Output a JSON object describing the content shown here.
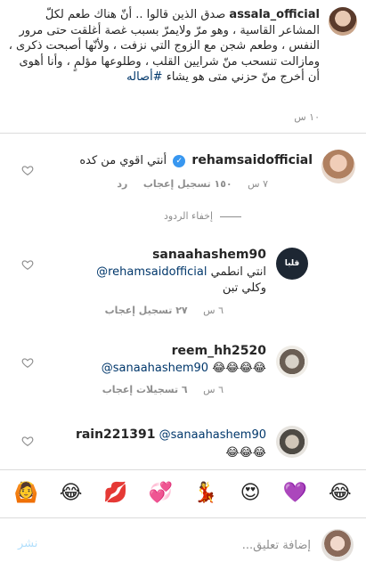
{
  "caption": {
    "username": "assala_official",
    "text_part1": "صدق الذين قالوا .. أنّ هناك طعم لكلّ المشاعر القاسية ، وهو مرّ ولايمرّ بسبب غصة أغلقت حتى مرور النفس ، وطعم شجن مع الزوج التي نزفت ، ولأنّها أصبحت ذكرى ، ومازالت تنسحب منّ شرايين القلب ، وطلوعها مؤلمٍ ، وأنا أهوى أن أخرج منّ حزني متى هو يشاء",
    "hashtag": "#أصاله",
    "time": "١٠ س"
  },
  "comments": [
    {
      "username": "rehamsaidofficial",
      "verified_mark": "✓",
      "text": "أنتي اقوي من كده",
      "time": "٧ س",
      "likes": "١٥٠ تسجيل إعجاب",
      "reply": "رد"
    },
    {
      "username": "sanaahashem90",
      "mention": "@rehamsaidofficial",
      "text_a": "انتي انطمي",
      "text_b": "وكلي تبن",
      "time": "٦ س",
      "likes": "٢٧ تسجيل إعجاب",
      "avatar_text": "قلبا"
    },
    {
      "username": "reem_hh2520",
      "mention": "@sanaahashem90",
      "emojis": "😂😂😂😂",
      "time": "٦ س",
      "likes": "٦ تسجيلات إعجاب"
    },
    {
      "username": "rain221391",
      "mention": "@sanaahashem90",
      "emojis": "😂😂😂"
    }
  ],
  "hide_replies": "إخفاء الردود",
  "emoji_bar": [
    "🙆",
    "😂",
    "💋",
    "💞",
    "💃",
    "😍",
    "💜",
    "😂"
  ],
  "input": {
    "placeholder": "إضافة تعليق...",
    "post_label": "نشر"
  },
  "colors": {
    "link": "#00376b",
    "meta": "#8e8e8e",
    "verified": "#3897f0",
    "post_disabled": "#b2dffc"
  }
}
